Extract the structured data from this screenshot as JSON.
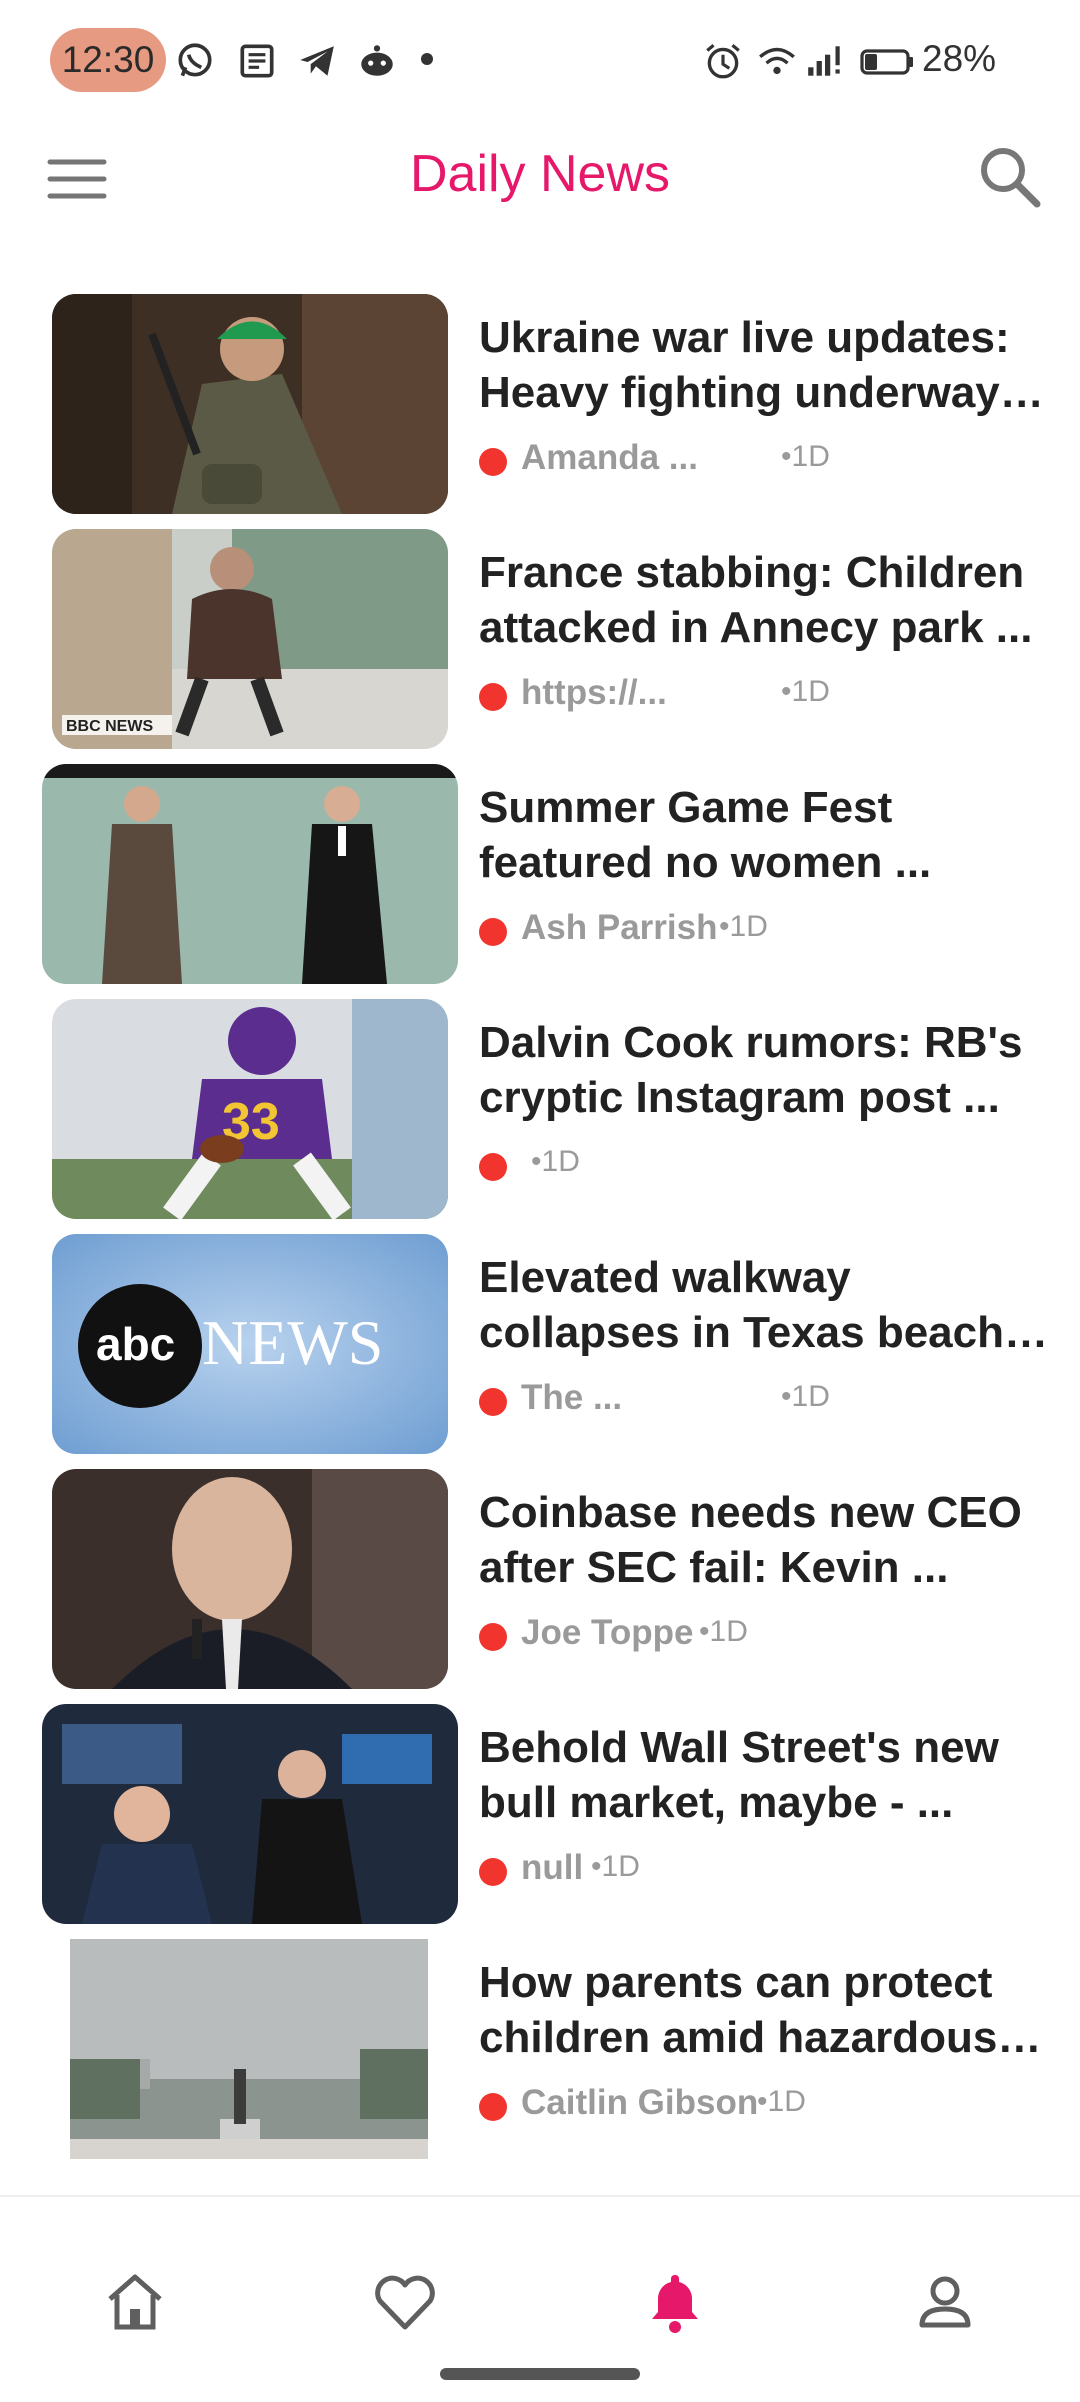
{
  "status_bar": {
    "time": "12:30",
    "battery_percent": "28%",
    "left_icons": [
      "whatsapp-icon",
      "news-icon",
      "telegram-icon",
      "reddit-icon",
      "dot-icon"
    ],
    "right_icons": [
      "alarm-icon",
      "wifi-icon",
      "signal-icon",
      "battery-icon"
    ]
  },
  "app_bar": {
    "title": "Daily News",
    "menu_icon": "hamburger-menu-icon",
    "search_icon": "search-icon",
    "accent_color": "#e6186a"
  },
  "news": [
    {
      "headline": "Ukraine war live updates: Heavy fighting underway in Ukraine as counteroffensive begins",
      "source": "Amanda ...",
      "age": "•1D",
      "image": "soldier-in-trench"
    },
    {
      "headline": "France stabbing: Children attacked in Annecy park ...",
      "source": "https://...",
      "age": "•1D",
      "image": "man-walking-bbc-news"
    },
    {
      "headline": "Summer Game Fest featured no women ...",
      "source": "Ash Parrish",
      "age": "•1D",
      "image": "two-presenters-on-stage"
    },
    {
      "headline": "Dalvin Cook rumors: RB's cryptic Instagram post ...",
      "source": "",
      "age": "•1D",
      "image": "football-player-vikings"
    },
    {
      "headline": "Elevated walkway collapses in Texas beach town, injuring several",
      "source": "The ...",
      "age": "•1D",
      "image": "abc-news-logo"
    },
    {
      "headline": "Coinbase needs new CEO after SEC fail: Kevin ...",
      "source": "Joe Toppe",
      "age": "•1D",
      "image": "man-speaking"
    },
    {
      "headline": "Behold Wall Street's new bull market, maybe - ...",
      "source": "null",
      "age": "•1D",
      "image": "stock-traders"
    },
    {
      "headline": "How parents can protect children amid hazardous air quality from wildfire smoke",
      "source": "Caitlin Gibson",
      "age": "•1D",
      "image": "hazy-city-skyline"
    }
  ],
  "bbc_watermark": "BBC NEWS",
  "abc_logo_text": {
    "abc": "abc",
    "news": "NEWS"
  },
  "bottom_nav": {
    "items": [
      {
        "icon": "home-icon",
        "active": false
      },
      {
        "icon": "heart-icon",
        "active": false
      },
      {
        "icon": "bell-icon",
        "active": true
      },
      {
        "icon": "profile-icon",
        "active": false
      }
    ],
    "active_color": "#e6186a",
    "inactive_color": "#5f5f5f"
  }
}
